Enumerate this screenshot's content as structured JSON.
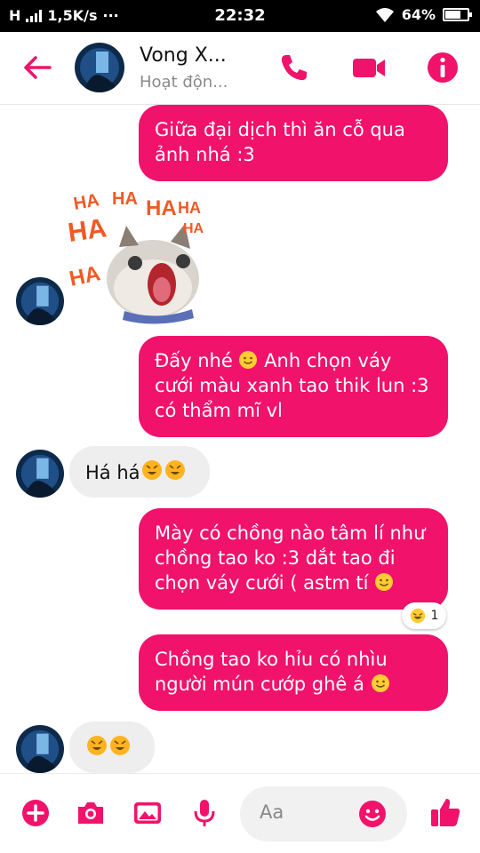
{
  "status_bar": {
    "network": "H",
    "speed": "1,5K/s",
    "dots": "···",
    "time": "22:32",
    "battery": "64%"
  },
  "header": {
    "contact_name": "Vong X...",
    "status": "Hoạt độn..."
  },
  "messages": {
    "m1": "Giữa đại dịch thì ăn cỗ qua ảnh nhá :3",
    "sticker_text": [
      "HA",
      "HA",
      "HA",
      "HA",
      "HA",
      "HA",
      "HA"
    ],
    "m2": "Đấy nhé",
    "m2b": "Anh chọn váy cưới màu xanh tao thik lun :3 có thẩm mĩ vl",
    "m3": "Há há",
    "m4": "Mày có chồng nào tâm lí như chồng tao ko :3 dắt tao đi chọn váy cưới ( astm tí",
    "m4_reaction_count": "1",
    "m5": "Chồng tao ko hỉu có nhìu người mún cướp ghê á"
  },
  "composer": {
    "placeholder": "Aa"
  },
  "colors": {
    "accent": "#f0126b",
    "incoming_bubble": "#eeeeee"
  },
  "icons": [
    "back-arrow-icon",
    "phone-icon",
    "video-icon",
    "info-icon",
    "plus-icon",
    "camera-icon",
    "image-icon",
    "mic-icon",
    "smile-icon",
    "like-icon"
  ]
}
